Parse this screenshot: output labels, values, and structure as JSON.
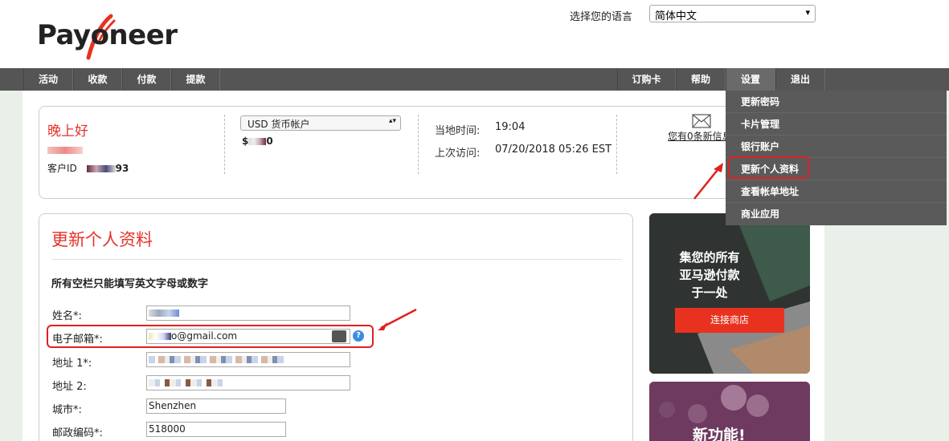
{
  "header": {
    "logo_text": "Payoneer",
    "language_label": "选择您的语言",
    "language_selected": "简体中文"
  },
  "nav": {
    "left": [
      "活动",
      "收款",
      "付款",
      "提款"
    ],
    "right": [
      "订购卡",
      "帮助",
      "设置",
      "退出"
    ]
  },
  "settings_menu": {
    "items": [
      "更新密码",
      "卡片管理",
      "银行账户",
      "更新个人资料",
      "查看帐单地址",
      "商业应用"
    ]
  },
  "info": {
    "greeting": "晚上好",
    "customer_id_label": "客户ID",
    "customer_id_suffix": "93",
    "account_select": "USD 货币帐户",
    "balance_prefix": "$",
    "balance_suffix": "0",
    "local_time_label": "当地时间:",
    "local_time_value": "19:04",
    "last_visit_label": "上次访问:",
    "last_visit_value": "07/20/2018 05:26 EST",
    "messages_text": "您有0条新信息"
  },
  "form": {
    "title": "更新个人资料",
    "note": "所有空栏只能填写英文字母或数字",
    "fields": [
      {
        "label": "姓名*:",
        "value": ""
      },
      {
        "label": "电子邮箱*:",
        "value": "o@gmail.com"
      },
      {
        "label": "地址 1*:",
        "value": ""
      },
      {
        "label": "地址 2:",
        "value": ""
      },
      {
        "label": "城市*:",
        "value": "Shenzhen"
      },
      {
        "label": "邮政编码*:",
        "value": "518000"
      }
    ],
    "help_icon": "?"
  },
  "promo": {
    "amazon_line1": "集您的所有",
    "amazon_line2": "亚马逊付款",
    "amazon_line3": "于一处",
    "connect_button": "连接商店",
    "new_feature": "新功能!"
  },
  "colors": {
    "brand_red": "#e3322b",
    "nav_gray": "#555555",
    "highlight_red": "#e02020"
  }
}
